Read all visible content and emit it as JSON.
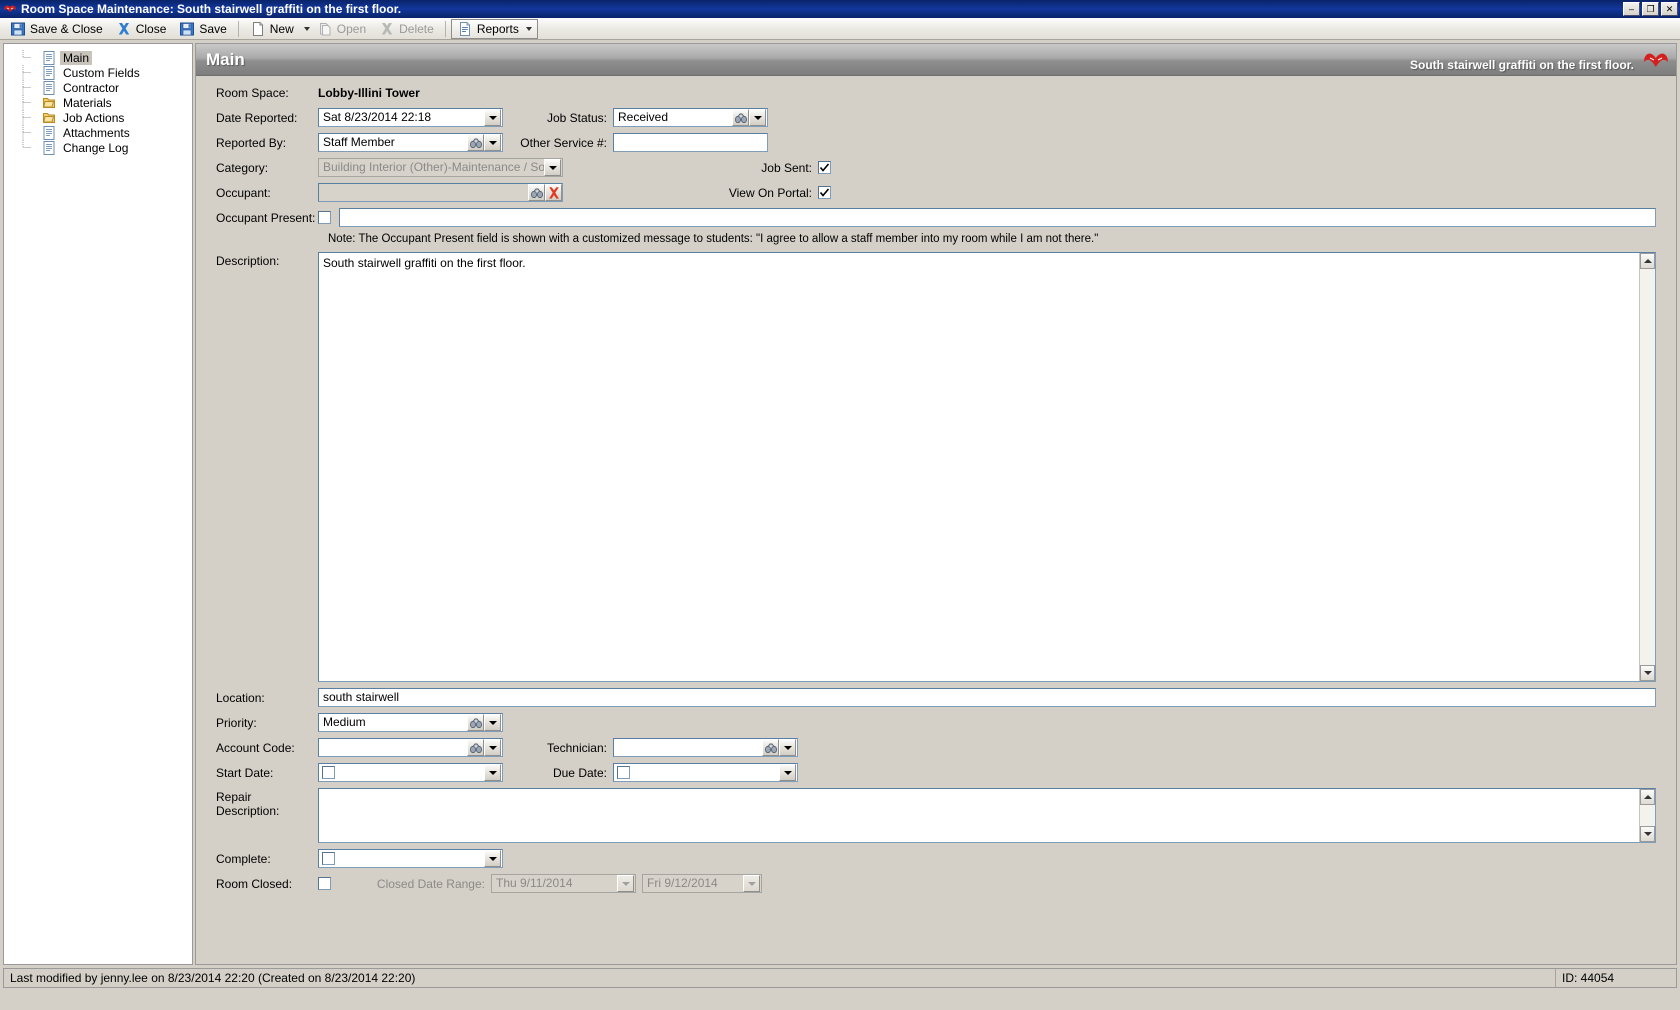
{
  "window": {
    "title": "Room Space Maintenance:  South stairwell graffiti on the first floor.",
    "icon": "app-icon",
    "minimize_label": "–",
    "maximize_label": "❐",
    "close_label": "✕"
  },
  "toolbar": {
    "save_close_label": "Save & Close",
    "close_label": "Close",
    "save_label": "Save",
    "new_label": "New",
    "open_label": "Open",
    "delete_label": "Delete",
    "reports_label": "Reports"
  },
  "sidebar": {
    "items": [
      {
        "label": "Main",
        "icon": "document-icon",
        "selected": true
      },
      {
        "label": "Custom Fields",
        "icon": "document-icon",
        "selected": false
      },
      {
        "label": "Contractor",
        "icon": "document-icon",
        "selected": false
      },
      {
        "label": "Materials",
        "icon": "folder-icon",
        "selected": false
      },
      {
        "label": "Job Actions",
        "icon": "folder-icon",
        "selected": false
      },
      {
        "label": "Attachments",
        "icon": "document-icon",
        "selected": false
      },
      {
        "label": "Change Log",
        "icon": "document-icon",
        "selected": false
      }
    ]
  },
  "pane": {
    "title": "Main",
    "subtitle": "South stairwell graffiti on the first floor.",
    "logo": "red-butterfly-logo"
  },
  "form": {
    "room_space_label": "Room Space:",
    "room_space_value": "Lobby-Illini Tower",
    "date_reported_label": "Date Reported:",
    "date_reported_value": "Sat   8/23/2014 22:18",
    "job_status_label": "Job Status:",
    "job_status_value": "Received",
    "reported_by_label": "Reported By:",
    "reported_by_value": "Staff Member",
    "other_service_label": "Other Service #:",
    "other_service_value": "",
    "category_label": "Category:",
    "category_value": "Building Interior (Other)-Maintenance / South",
    "job_sent_label": "Job Sent:",
    "job_sent_checked": true,
    "occupant_label": "Occupant:",
    "occupant_value": "",
    "view_on_portal_label": "View On Portal:",
    "view_on_portal_checked": true,
    "occupant_present_label": "Occupant Present:",
    "occupant_present_checked": false,
    "occupant_present_value": "",
    "note": "Note: The Occupant Present field is shown with a customized message to students: \"I agree to allow a staff member into my room while I am not there.\"",
    "description_label": "Description:",
    "description_value": "South stairwell graffiti on the first floor.",
    "location_label": "Location:",
    "location_value": "south stairwell",
    "priority_label": "Priority:",
    "priority_value": "Medium",
    "account_code_label": "Account Code:",
    "account_code_value": "",
    "technician_label": "Technician:",
    "technician_value": "",
    "start_date_label": "Start Date:",
    "start_date_checked": false,
    "start_date_value": "",
    "due_date_label": "Due Date:",
    "due_date_checked": false,
    "due_date_value": "",
    "repair_description_label": "Repair Description:",
    "repair_description_value": "",
    "complete_label": "Complete:",
    "complete_checked": false,
    "complete_value": "",
    "room_closed_label": "Room Closed:",
    "room_closed_checked": false,
    "closed_date_range_label": "Closed Date Range:",
    "closed_date_from": "Thu   9/11/2014",
    "closed_date_to": "Fri   9/12/2014"
  },
  "statusbar": {
    "left": "Last modified by jenny.lee on 8/23/2014 22:20  (Created on 8/23/2014 22:20)",
    "right": "ID: 44054"
  },
  "colors": {
    "title_bar": "#0a246a",
    "face": "#d4d0c8",
    "field_border": "#7f9db9",
    "accent_red": "#cc2222"
  }
}
